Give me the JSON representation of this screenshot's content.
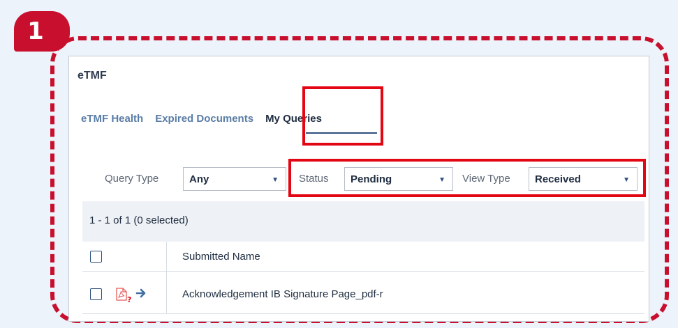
{
  "step_badge": "1",
  "section": {
    "title": "eTMF"
  },
  "tabs": [
    {
      "label": "eTMF Health"
    },
    {
      "label": "Expired Documents"
    },
    {
      "label": "My Queries"
    }
  ],
  "filters": {
    "query_type": {
      "label": "Query Type",
      "value": "Any"
    },
    "status": {
      "label": "Status",
      "value": "Pending"
    },
    "view_type": {
      "label": "View Type",
      "value": "Received"
    }
  },
  "results": {
    "count_text": "1 - 1 of 1 (0 selected)"
  },
  "table": {
    "column_header": "Submitted Name",
    "rows": [
      {
        "name": "Acknowledgement IB Signature Page_pdf-r",
        "icons": [
          "pdf-query-icon",
          "arrow-right-icon"
        ]
      }
    ]
  },
  "colors": {
    "highlight": "#e30613",
    "accent": "#2c4f7c",
    "badge": "#c8102e"
  }
}
